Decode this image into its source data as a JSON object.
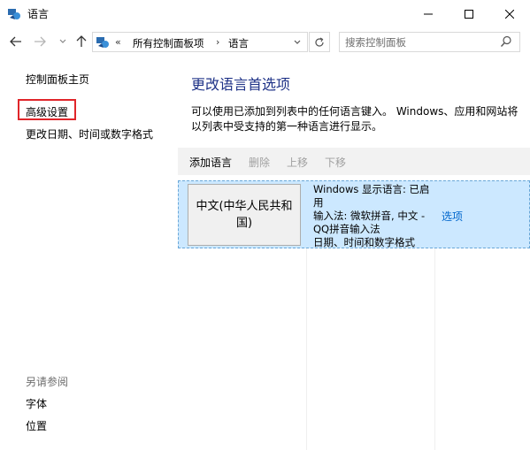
{
  "window": {
    "title": "语言"
  },
  "nav": {
    "address": {
      "prefix": "«",
      "crumb1": "所有控制面板项",
      "separator": "›",
      "crumb2": "语言"
    },
    "search_placeholder": "搜索控制面板"
  },
  "sidebar": {
    "home": "控制面板主页",
    "advanced": "高级设置",
    "datetime": "更改日期、时间或数字格式",
    "see_also": "另请参阅",
    "fonts": "字体",
    "location": "位置"
  },
  "main": {
    "heading": "更改语言首选项",
    "description": "可以使用已添加到列表中的任何语言键入。 Windows、应用和网站将以列表中受支持的第一种语言进行显示。",
    "toolbar": {
      "add": "添加语言",
      "remove": "删除",
      "move_up": "上移",
      "move_down": "下移"
    },
    "languages": [
      {
        "name": "中文(中华人民共和国)",
        "info": [
          "Windows 显示语言: 已启用",
          "输入法: 微软拼音, 中文 - QQ拼音输入法",
          "日期、时间和数字格式"
        ],
        "options": "选项"
      }
    ]
  },
  "colors": {
    "accent_heading": "#1e3287",
    "link": "#0066cc",
    "selection": "#cce8ff",
    "highlight_box": "#e0252a"
  }
}
